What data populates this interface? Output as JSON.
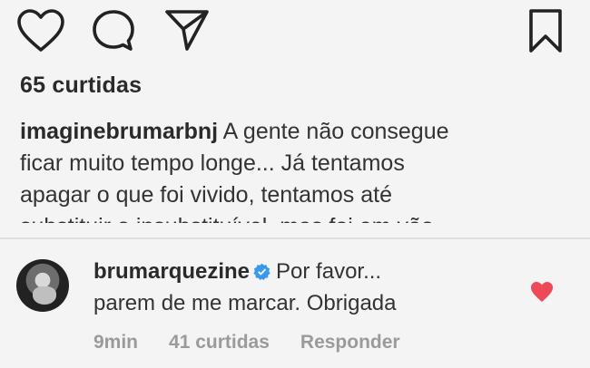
{
  "post": {
    "likes_text": "65 curtidas",
    "caption": {
      "username": "imaginebrumarbnj",
      "lines": [
        "A gente não consegue",
        "ficar muito tempo longe... Já tentamos",
        "apagar o que foi vivido, tentamos até",
        "substituir o insubstituível, mas foi em vão..."
      ]
    }
  },
  "comment": {
    "username": "brumarquezine",
    "text_line1": "Por favor...",
    "text_line2": "parem de me marcar. Obrigada",
    "time": "9min",
    "likes": "41 curtidas",
    "reply_label": "Responder",
    "liked_color": "#ed4956",
    "verified_color": "#3897f0"
  },
  "icons": {
    "action_bar": [
      "heart-icon",
      "comment-icon",
      "share-icon",
      "bookmark-icon"
    ]
  }
}
